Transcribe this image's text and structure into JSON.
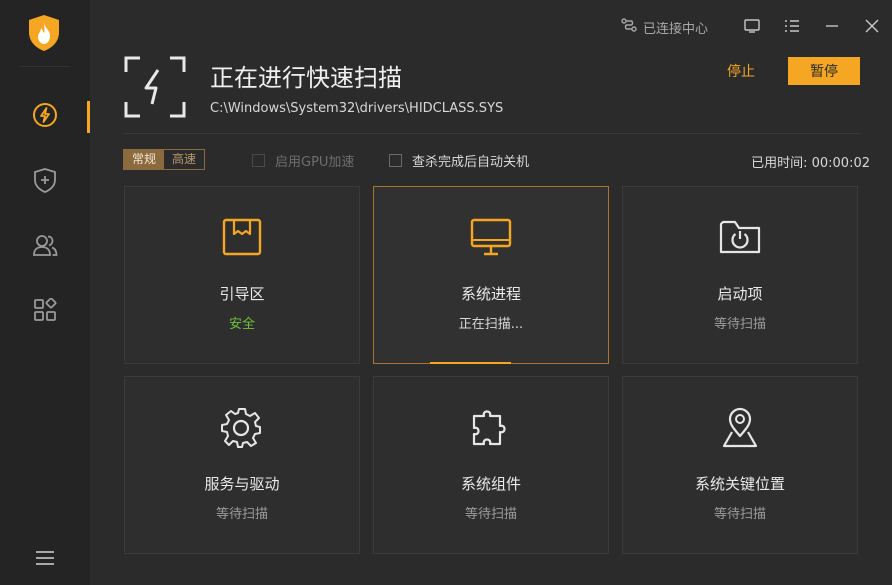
{
  "app": {
    "colors": {
      "accent": "#f5a623",
      "safe": "#6fc23a",
      "background": "#2b2b2b",
      "sidebar": "#242424"
    }
  },
  "sidebar": {
    "logo_icon": "flame-shield-icon",
    "items": [
      {
        "icon": "lightning-icon",
        "active": true
      },
      {
        "icon": "shield-plus-icon",
        "active": false
      },
      {
        "icon": "users-icon",
        "active": false
      },
      {
        "icon": "apps-grid-icon",
        "active": false
      }
    ],
    "menu_icon": "hamburger-menu-icon"
  },
  "topbar": {
    "connect_label": "已连接中心",
    "connect_icon": "link-icon"
  },
  "scan": {
    "title": "正在进行快速扫描",
    "current_path": "C:\\Windows\\System32\\drivers\\HIDCLASS.SYS",
    "stop_label": "停止",
    "pause_label": "暂停"
  },
  "options": {
    "mode_normal": "常规",
    "mode_fast": "高速",
    "gpu_label": "启用GPU加速",
    "gpu_checked": false,
    "gpu_enabled": false,
    "shutdown_label": "查杀完成后自动关机",
    "shutdown_checked": false,
    "elapsed_label": "已用时间:",
    "elapsed_value": "00:00:02"
  },
  "cards": [
    {
      "name": "引导区",
      "status": "安全",
      "icon": "boot-sector-icon",
      "state": "safe"
    },
    {
      "name": "系统进程",
      "status": "正在扫描...",
      "icon": "monitor-icon",
      "state": "scanning",
      "progress": 0.45
    },
    {
      "name": "启动项",
      "status": "等待扫描",
      "icon": "startup-folder-icon",
      "state": "waiting"
    },
    {
      "name": "服务与驱动",
      "status": "等待扫描",
      "icon": "gear-icon",
      "state": "waiting"
    },
    {
      "name": "系统组件",
      "status": "等待扫描",
      "icon": "puzzle-icon",
      "state": "waiting"
    },
    {
      "name": "系统关键位置",
      "status": "等待扫描",
      "icon": "location-pin-icon",
      "state": "waiting"
    }
  ]
}
